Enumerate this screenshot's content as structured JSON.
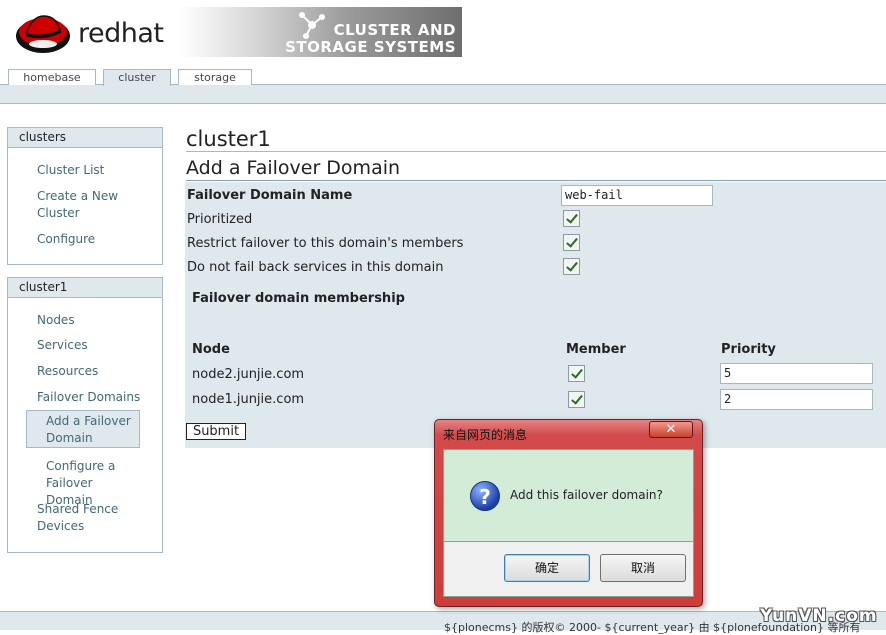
{
  "header": {
    "logo_text": "redhat",
    "banner_line1": "CLUSTER AND",
    "banner_line2": "STORAGE SYSTEMS"
  },
  "tabs": [
    {
      "label": "homebase"
    },
    {
      "label": "cluster"
    },
    {
      "label": "storage"
    }
  ],
  "sidebar": {
    "clusters_portlet": {
      "title": "clusters",
      "items": [
        "Cluster List",
        "Create a New Cluster",
        "Configure"
      ]
    },
    "cluster_portlet": {
      "title": "cluster1",
      "items": [
        "Nodes",
        "Services",
        "Resources",
        "Failover Domains",
        "Add a Failover Domain",
        "Configure a Failover Domain",
        "Shared Fence Devices"
      ]
    }
  },
  "main": {
    "cluster_name": "cluster1",
    "heading": "Add a Failover Domain",
    "form": {
      "name_label": "Failover Domain Name",
      "name_value": "web-fail",
      "prioritized_label": "Prioritized",
      "restricted_label": "Restrict failover to this domain's members",
      "nofailback_label": "Do not fail back services in this domain",
      "membership_heading": "Failover domain membership",
      "columns": {
        "node": "Node",
        "member": "Member",
        "priority": "Priority"
      },
      "nodes": [
        {
          "name": "node2.junjie.com",
          "priority": "5"
        },
        {
          "name": "node1.junjie.com",
          "priority": "2"
        }
      ],
      "submit_label": "Submit"
    }
  },
  "dialog": {
    "title": "来自网页的消息",
    "close_label": "✕",
    "message": "Add this failover domain?",
    "ok_label": "确定",
    "cancel_label": "取消"
  },
  "footer": {
    "text": "${plonecms} 的版权© 2000- ${current_year} 由 ${plonefoundation} 等所有",
    "watermark": "YunVN.com"
  },
  "colors": {
    "panel_bg": "#dfe8ed",
    "border": "#a7b9c5",
    "link": "#436976",
    "dialog_frame": "#cf3b3b",
    "dialog_body": "#d3ecd8"
  }
}
